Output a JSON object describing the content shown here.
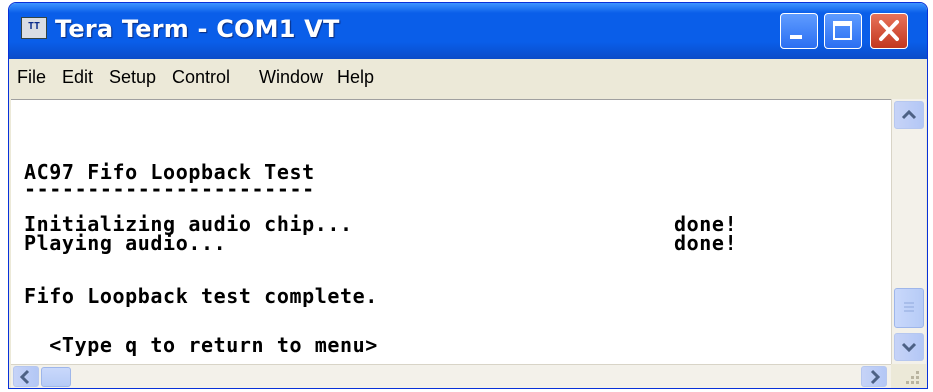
{
  "window": {
    "title": "Tera Term - COM1 VT"
  },
  "menu": [
    "File",
    "Edit",
    "Setup",
    "Control",
    "Window",
    "Help"
  ],
  "terminal": {
    "heading": "AC97 Fifo Loopback Test",
    "separator": "-----------------------",
    "rows": [
      {
        "text": "Initializing audio chip...",
        "status": "done!"
      },
      {
        "text": "Playing audio...",
        "status": "done!"
      }
    ],
    "complete": "Fifo Loopback test complete.",
    "prompt": "  <Type q to return to menu>"
  },
  "colors": {
    "titlebar": "#0a5ee9",
    "close": "#c2371f",
    "terminal_bg": "#ffffff",
    "text": "#000000"
  },
  "icons": [
    "tera-term-icon",
    "minimize-icon",
    "maximize-icon",
    "close-icon",
    "scroll-up-icon",
    "scroll-down-icon",
    "scroll-left-icon",
    "scroll-right-icon",
    "resize-grip-icon"
  ]
}
